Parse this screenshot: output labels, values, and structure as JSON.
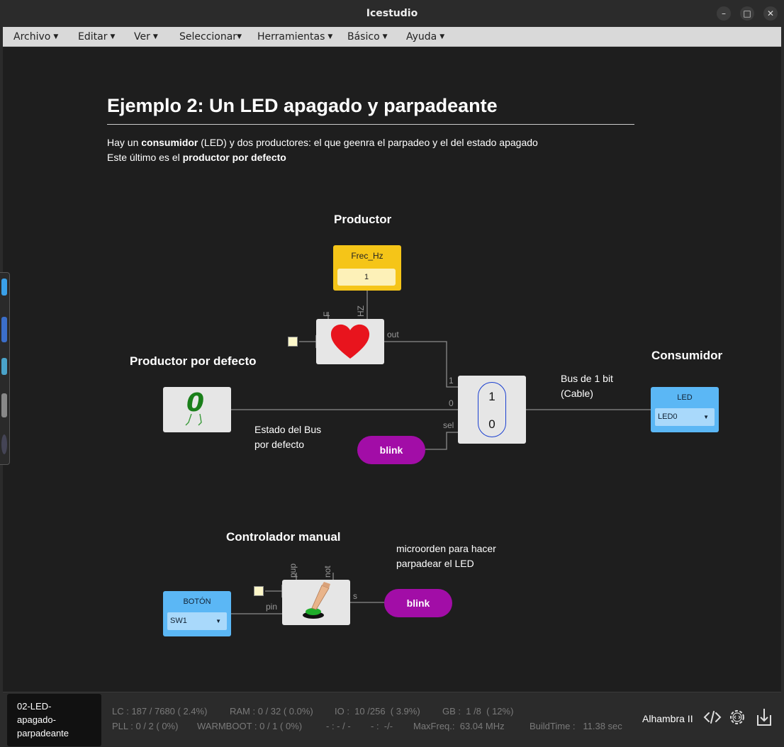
{
  "window": {
    "title": "Icestudio",
    "controls": {
      "minimize": "–",
      "maximize": "□",
      "close": "✕"
    }
  },
  "menu": {
    "items": [
      {
        "label": "Archivo"
      },
      {
        "label": "Editar"
      },
      {
        "label": "Ver"
      },
      {
        "label": "Seleccionar"
      },
      {
        "label": "Herramientas"
      },
      {
        "label": "Básico"
      },
      {
        "label": "Ayuda"
      }
    ]
  },
  "doc": {
    "title": "Ejemplo 2: Un LED apagado y parpadeante",
    "line1_pre": "Hay un ",
    "line1_bold": "consumidor",
    "line1_post": " (LED) y dos productores: el que geenra el parpadeo y el del estado apagado",
    "line2_pre": "Este último es el ",
    "line2_bold": "productor por defecto"
  },
  "circuit": {
    "heading_productor": "Productor",
    "heading_defecto": "Productor por defecto",
    "heading_consumidor": "Consumidor",
    "heading_manual": "Controlador manual",
    "freq_block": {
      "label": "Frec_Hz",
      "value": "1"
    },
    "heart_block": {
      "port_f": "F",
      "port_hz": "HZ",
      "port_out": "out"
    },
    "zero_block": {
      "value": "0"
    },
    "mux_block": {
      "in1": "1",
      "in0": "0",
      "sel": "sel",
      "top": "1",
      "bottom": "0"
    },
    "note_bus": {
      "line1": "Bus de 1 bit",
      "line2": "(Cable)"
    },
    "note_estado": {
      "line1": "Estado del Bus",
      "line2": "por defecto"
    },
    "note_micro": {
      "line1": "microorden para hacer",
      "line2": "parpadear el LED"
    },
    "led_block": {
      "label": "LED",
      "value": "LED0"
    },
    "boton_block": {
      "label": "BOTÓN",
      "value": "SW1"
    },
    "blink1": "blink",
    "blink2": "blink",
    "btn_block": {
      "port_pup": "pup",
      "port_not": "not",
      "port_pin": "pin",
      "port_s": "s"
    }
  },
  "status": {
    "project_lines": [
      "02-LED-",
      "apagado-",
      "parpadeante"
    ],
    "lc": "LC : 187 / 7680 ( 2.4%)",
    "ram": "RAM : 0 / 32 ( 0.0%)",
    "io": "IO :  10 /256  ( 3.9%)",
    "gb": "GB :  1 /8  ( 12%)",
    "pll": "PLL : 0 / 2 ( 0%)",
    "warmboot": "WARMBOOT : 0 / 1 ( 0%)",
    "t1": "- : - / -",
    "t2": "- :  -/-",
    "maxfreq": "MaxFreq.:  63.04 MHz",
    "buildtime": "BuildTime :   11.38 sec",
    "board": "Alhambra II"
  }
}
